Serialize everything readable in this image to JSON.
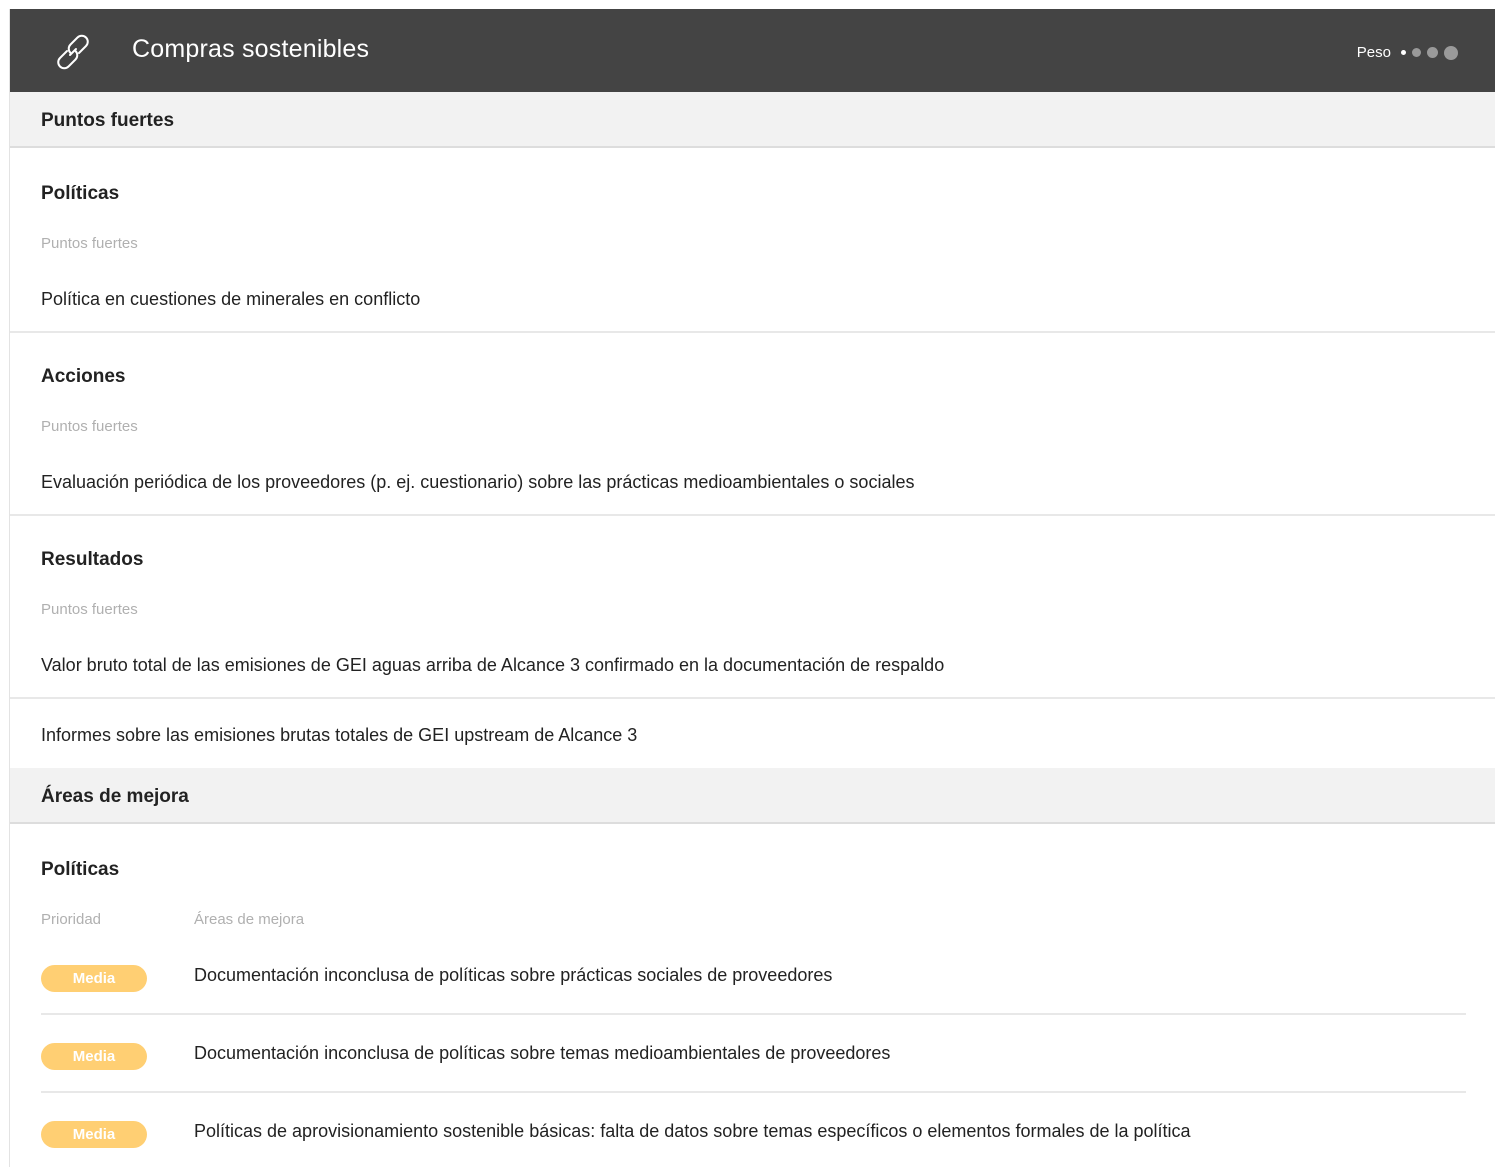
{
  "header": {
    "title": "Compras sostenibles",
    "weight_label": "Peso",
    "icon": "link-icon",
    "background": "#444444"
  },
  "strengths": {
    "section_title": "Puntos fuertes",
    "groups": [
      {
        "title": "Políticas",
        "col_label": "Puntos fuertes",
        "items": [
          "Política en cuestiones de minerales en conflicto"
        ]
      },
      {
        "title": "Acciones",
        "col_label": "Puntos fuertes",
        "items": [
          "Evaluación periódica de los proveedores (p. ej. cuestionario) sobre las prácticas medioambientales o sociales"
        ]
      },
      {
        "title": "Resultados",
        "col_label": "Puntos fuertes",
        "items": [
          "Valor bruto total de las emisiones de GEI aguas arriba de Alcance 3 confirmado en la documentación de respaldo",
          "Informes sobre las emisiones brutas totales de GEI upstream de Alcance 3"
        ]
      }
    ]
  },
  "improvements": {
    "section_title": "Áreas de mejora",
    "groups": [
      {
        "title": "Políticas",
        "col_priority": "Prioridad",
        "col_area": "Áreas de mejora",
        "items": [
          {
            "priority": "Media",
            "text": "Documentación inconclusa de políticas sobre prácticas sociales de proveedores"
          },
          {
            "priority": "Media",
            "text": "Documentación inconclusa de políticas sobre temas medioambientales de proveedores"
          },
          {
            "priority": "Media",
            "text": "Políticas de aprovisionamiento sostenible básicas: falta de datos sobre temas específicos o elementos formales de la política"
          }
        ]
      }
    ]
  },
  "colors": {
    "badge_medium": "#ffcf73",
    "section_bg": "#f2f2f2"
  }
}
